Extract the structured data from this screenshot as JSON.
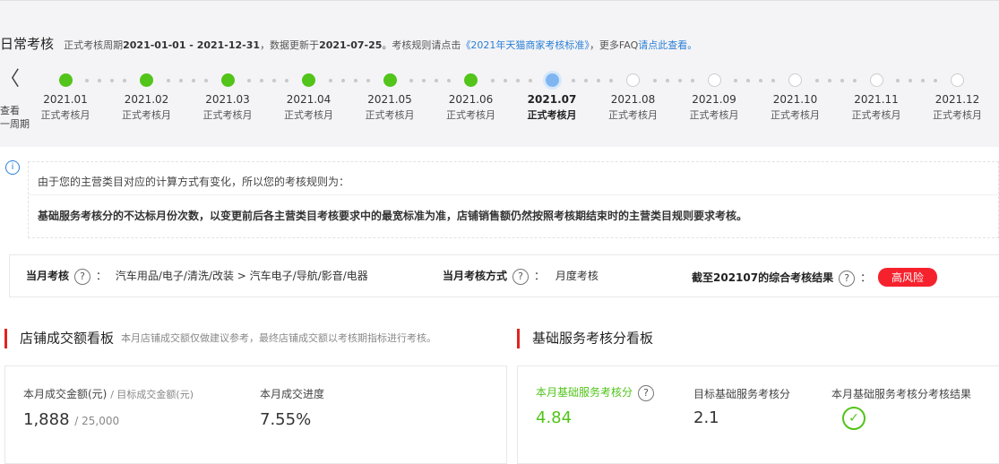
{
  "header": {
    "title": "日常考核",
    "period_prefix": "正式考核周期",
    "period": "2021-01-01 - 2021-12-31",
    "updated_prefix": "，数据更新于",
    "updated": "2021-07-25",
    "rule_prefix": "。考核规则请点击",
    "rule_link": "《2021年天猫商家考核标准》",
    "faq_prefix": "，更多FAQ",
    "faq_link": "请点此查看。"
  },
  "nav": {
    "prev_icon": "chevron-left-icon",
    "prev_glyph": "〈",
    "prev_line1": "查看",
    "prev_line2": "一周期"
  },
  "timeline": [
    {
      "month": "2021.01",
      "label": "正式考核月",
      "status": "done"
    },
    {
      "month": "2021.02",
      "label": "正式考核月",
      "status": "done"
    },
    {
      "month": "2021.03",
      "label": "正式考核月",
      "status": "done"
    },
    {
      "month": "2021.04",
      "label": "正式考核月",
      "status": "done"
    },
    {
      "month": "2021.05",
      "label": "正式考核月",
      "status": "done"
    },
    {
      "month": "2021.06",
      "label": "正式考核月",
      "status": "done"
    },
    {
      "month": "2021.07",
      "label": "正式考核月",
      "status": "current"
    },
    {
      "month": "2021.08",
      "label": "正式考核月",
      "status": "todo"
    },
    {
      "month": "2021.09",
      "label": "正式考核月",
      "status": "todo"
    },
    {
      "month": "2021.10",
      "label": "正式考核月",
      "status": "todo"
    },
    {
      "month": "2021.11",
      "label": "正式考核月",
      "status": "todo"
    },
    {
      "month": "2021.12",
      "label": "正式考核月",
      "status": "todo"
    }
  ],
  "notice": {
    "icon": "info-icon",
    "icon_glyph": "i",
    "line1": "由于您的主营类目对应的计算方式有变化，所以您的考核规则为：",
    "line2": "基础服务考核分的不达标月份次数，以变更前后各主营类目考核要求中的最宽标准为准，店铺销售额仍然按照考核期结束时的主营类目规则要求考核。"
  },
  "info_row": {
    "q_glyph": "?",
    "month_label": "当月考核",
    "colon": "：",
    "category": "汽车用品/电子/清洗/改装 > 汽车电子/导航/影音/电器",
    "method_label": "当月考核方式",
    "method": "月度考核",
    "result_label": "截至202107的综合考核结果",
    "result_badge": "高风险"
  },
  "sales_board": {
    "title": "店铺成交额看板",
    "subtitle": "本月店铺成交额仅做建议参考，最终店铺成交额以考核期指标进行考核。",
    "amount_label": "本月成交金额(元)",
    "target_label": "/ 目标成交金额(元)",
    "amount": "1,888",
    "target": "/ 25,000",
    "progress_label": "本月成交进度",
    "progress": "7.55%"
  },
  "service_board": {
    "title": "基础服务考核分看板",
    "score_label": "本月基础服务考核分",
    "score": "4.84",
    "target_label": "目标基础服务考核分",
    "target": "2.1",
    "result_label": "本月基础服务考核分考核结果",
    "result_icon": "check-circle-icon",
    "result_glyph": "✓"
  },
  "colors": {
    "done": "#52c41a",
    "current": "#7fb6f2",
    "risk": "#f5222d",
    "accent_bar": "#e0241f",
    "link": "#2a7fd6"
  }
}
